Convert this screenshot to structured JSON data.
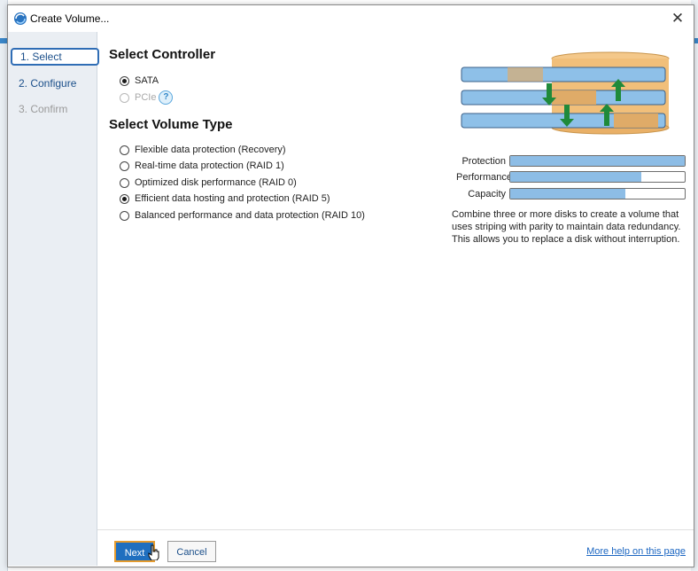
{
  "window": {
    "title": "Create Volume..."
  },
  "steps": [
    {
      "label": "1. Select",
      "state": "active"
    },
    {
      "label": "2. Configure",
      "state": "enabled"
    },
    {
      "label": "3. Confirm",
      "state": "disabled"
    }
  ],
  "controller": {
    "heading": "Select Controller",
    "options": [
      {
        "label": "SATA",
        "checked": true,
        "enabled": true
      },
      {
        "label": "PCIe",
        "checked": false,
        "enabled": false
      }
    ]
  },
  "volume_type": {
    "heading": "Select Volume Type",
    "options": [
      {
        "label": "Flexible data protection (Recovery)",
        "checked": false
      },
      {
        "label": "Real-time data protection (RAID 1)",
        "checked": false
      },
      {
        "label": "Optimized disk performance (RAID 0)",
        "checked": false
      },
      {
        "label": "Efficient data hosting and protection (RAID 5)",
        "checked": true
      },
      {
        "label": "Balanced performance and data protection (RAID 10)",
        "checked": false
      }
    ]
  },
  "metrics": [
    {
      "label": "Protection",
      "value": 1.0
    },
    {
      "label": "Performance",
      "value": 0.75
    },
    {
      "label": "Capacity",
      "value": 0.66
    }
  ],
  "description": "Combine three or more disks to create a volume that uses striping with parity to maintain data redundancy. This allows you to replace a disk without interruption.",
  "buttons": {
    "next": "Next",
    "cancel": "Cancel"
  },
  "help_link": "More help on this page",
  "colors": {
    "accent": "#1f6fbf",
    "bar_fill": "#8dbde6",
    "focus_border": "#e59b2e"
  },
  "icons": {
    "title": "raid-app-icon",
    "close": "close-icon",
    "help": "question-icon",
    "diagram": "raid5-disks-diagram"
  }
}
